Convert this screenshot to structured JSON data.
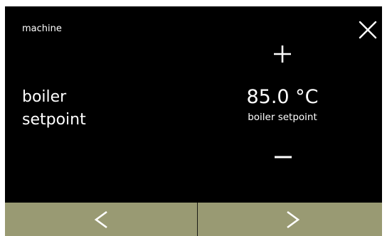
{
  "header": {
    "title": "machine"
  },
  "parameter": {
    "name_line1": "boiler",
    "name_line2": "setpoint",
    "value": "85.0 °C",
    "value_label": "boiler setpoint"
  },
  "icons": {
    "close": "close-icon",
    "increase": "plus-icon",
    "decrease": "minus-icon",
    "previous": "chevron-left-icon",
    "next": "chevron-right-icon"
  },
  "colors": {
    "background": "#000000",
    "text": "#ffffff",
    "nav_bar": "#999a73"
  }
}
